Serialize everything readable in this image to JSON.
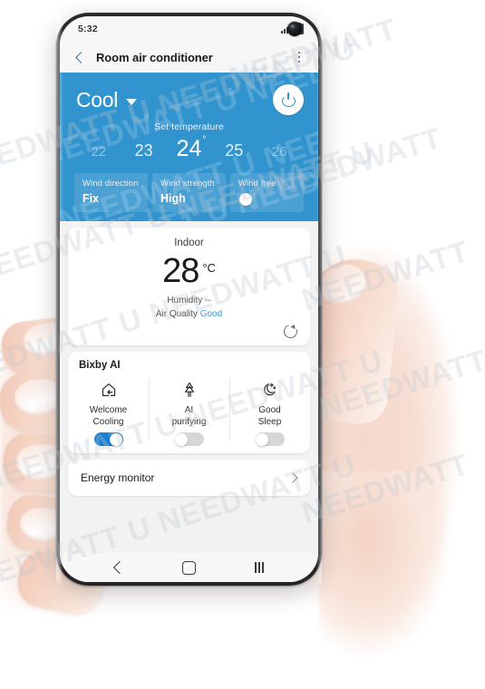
{
  "statusbar": {
    "time": "5:32",
    "signal_icon": "signal-bars-icon",
    "battery_icon": "battery-icon",
    "camera_icon": "front-camera-punchhole"
  },
  "appbar": {
    "back_icon": "back-chevron-icon",
    "title": "Room air conditioner",
    "menu_icon": "kebab-menu-icon"
  },
  "control_panel": {
    "mode": "Cool",
    "mode_caret_icon": "chevron-down-icon",
    "power_icon": "power-icon",
    "set_temperature_label": "Set temperature",
    "temperature_scale": [
      {
        "value": "22",
        "state": "far"
      },
      {
        "value": "23",
        "state": "near"
      },
      {
        "value": "24",
        "state": "selected",
        "degree": "°"
      },
      {
        "value": "25",
        "state": "near"
      },
      {
        "value": "26",
        "state": "far"
      }
    ],
    "chips": [
      {
        "label": "Wind direction",
        "value": "Fix",
        "type": "text"
      },
      {
        "label": "Wind strength",
        "value": "High",
        "type": "text"
      },
      {
        "label": "Wind free",
        "value": "",
        "type": "switch",
        "on": false
      }
    ],
    "accent_color": "#3294ce"
  },
  "indoor_card": {
    "title": "Indoor",
    "temperature": "28",
    "unit": "°C",
    "humidity_line": "Humidity --",
    "air_quality_label": "Air Quality ",
    "air_quality_value": "Good",
    "air_quality_color": "#3a9ad9",
    "refresh_icon": "refresh-icon"
  },
  "bixby_card": {
    "title": "Bixby AI",
    "items": [
      {
        "icon": "home-arrow-icon",
        "label": "Welcome\nCooling",
        "line1": "Welcome",
        "line2": "Cooling",
        "toggle_on": true
      },
      {
        "icon": "tree-icon",
        "label": "AI purifying",
        "line1": "AI",
        "line2": "purifying",
        "toggle_on": false
      },
      {
        "icon": "moon-stars-icon",
        "label": "Good Sleep",
        "line1": "Good",
        "line2": "Sleep",
        "toggle_on": false
      }
    ],
    "toggle_on_color": "#1a7fd4"
  },
  "energy_card": {
    "label": "Energy monitor",
    "chevron_icon": "chevron-right-icon"
  },
  "navbar": {
    "back_icon": "nav-back-icon",
    "home_icon": "nav-home-icon",
    "recents_icon": "nav-recents-icon"
  },
  "watermark": {
    "text": "NEEDWATT U NEEDWATT U",
    "short": "NEEDWATT"
  }
}
